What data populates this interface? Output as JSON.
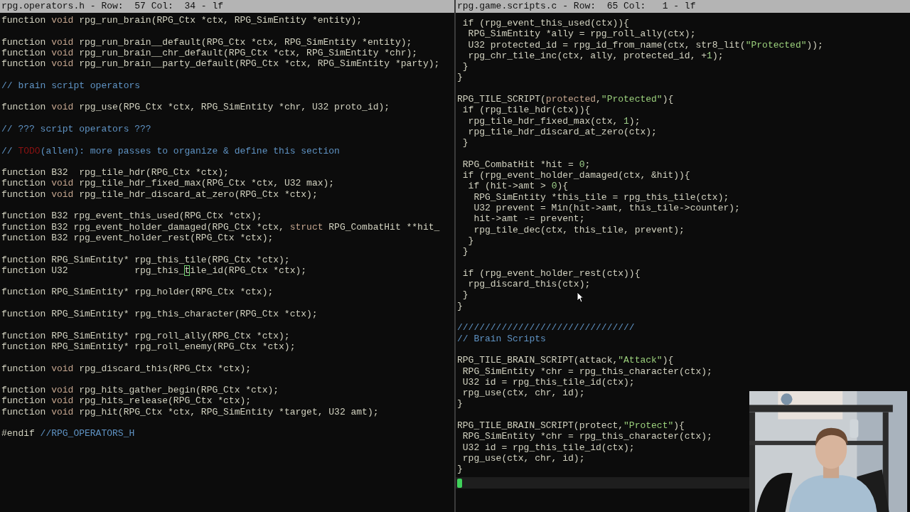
{
  "panes": [
    {
      "status_bar": "rpg.operators.h - Row:  57 Col:  34 - lf",
      "lines": [
        {
          "kind": "code",
          "tokens": [
            {
              "kind": "plain",
              "text": "function "
            },
            {
              "kind": "keyword",
              "text": "void"
            },
            {
              "kind": "plain",
              "text": " rpg_run_brain(RPG_Ctx *ctx, RPG_SimEntity *entity);"
            }
          ]
        },
        {
          "kind": "blank"
        },
        {
          "kind": "code",
          "tokens": [
            {
              "kind": "plain",
              "text": "function "
            },
            {
              "kind": "keyword",
              "text": "void"
            },
            {
              "kind": "plain",
              "text": " rpg_run_brain__default(RPG_Ctx *ctx, RPG_SimEntity *entity);"
            }
          ]
        },
        {
          "kind": "code",
          "tokens": [
            {
              "kind": "plain",
              "text": "function "
            },
            {
              "kind": "keyword",
              "text": "void"
            },
            {
              "kind": "plain",
              "text": " rpg_run_brain__chr_default(RPG_Ctx *ctx, RPG_SimEntity *chr);"
            }
          ]
        },
        {
          "kind": "code",
          "tokens": [
            {
              "kind": "plain",
              "text": "function "
            },
            {
              "kind": "keyword",
              "text": "void"
            },
            {
              "kind": "plain",
              "text": " rpg_run_brain__party_default(RPG_Ctx *ctx, RPG_SimEntity *party);"
            }
          ]
        },
        {
          "kind": "blank"
        },
        {
          "kind": "code",
          "tokens": [
            {
              "kind": "comment",
              "text": "// brain script operators"
            }
          ]
        },
        {
          "kind": "blank"
        },
        {
          "kind": "code",
          "tokens": [
            {
              "kind": "plain",
              "text": "function "
            },
            {
              "kind": "keyword",
              "text": "void"
            },
            {
              "kind": "plain",
              "text": " rpg_use(RPG_Ctx *ctx, RPG_SimEntity *chr, U32 proto_id);"
            }
          ]
        },
        {
          "kind": "blank"
        },
        {
          "kind": "code",
          "tokens": [
            {
              "kind": "comment",
              "text": "// ??? script operators ???"
            }
          ]
        },
        {
          "kind": "blank"
        },
        {
          "kind": "code",
          "tokens": [
            {
              "kind": "comment",
              "text": "// "
            },
            {
              "kind": "todo",
              "text": "TODO"
            },
            {
              "kind": "comment",
              "text": "(allen): more passes to organize & define this section"
            }
          ]
        },
        {
          "kind": "blank"
        },
        {
          "kind": "code",
          "tokens": [
            {
              "kind": "plain",
              "text": "function B32  rpg_tile_hdr(RPG_Ctx *ctx);"
            }
          ]
        },
        {
          "kind": "code",
          "tokens": [
            {
              "kind": "plain",
              "text": "function "
            },
            {
              "kind": "keyword",
              "text": "void"
            },
            {
              "kind": "plain",
              "text": " rpg_tile_hdr_fixed_max(RPG_Ctx *ctx, U32 max);"
            }
          ]
        },
        {
          "kind": "code",
          "tokens": [
            {
              "kind": "plain",
              "text": "function "
            },
            {
              "kind": "keyword",
              "text": "void"
            },
            {
              "kind": "plain",
              "text": " rpg_tile_hdr_discard_at_zero(RPG_Ctx *ctx);"
            }
          ]
        },
        {
          "kind": "blank"
        },
        {
          "kind": "code",
          "tokens": [
            {
              "kind": "plain",
              "text": "function B32 rpg_event_this_used(RPG_Ctx *ctx);"
            }
          ]
        },
        {
          "kind": "code",
          "tokens": [
            {
              "kind": "plain",
              "text": "function B32 rpg_event_holder_damaged(RPG_Ctx *ctx, "
            },
            {
              "kind": "keyword",
              "text": "struct"
            },
            {
              "kind": "plain",
              "text": " RPG_CombatHit **hit_"
            }
          ]
        },
        {
          "kind": "code",
          "tokens": [
            {
              "kind": "plain",
              "text": "function B32 rpg_event_holder_rest(RPG_Ctx *ctx);"
            }
          ]
        },
        {
          "kind": "blank"
        },
        {
          "kind": "code",
          "tokens": [
            {
              "kind": "plain",
              "text": "function RPG_SimEntity* rpg_this_tile(RPG_Ctx *ctx);"
            }
          ]
        },
        {
          "kind": "code",
          "tokens": [
            {
              "kind": "plain",
              "text": "function U32            rpg_this_"
            },
            {
              "kind": "cursor",
              "text": "t"
            },
            {
              "kind": "plain",
              "text": "ile_id(RPG_Ctx *ctx);"
            }
          ]
        },
        {
          "kind": "blank"
        },
        {
          "kind": "code",
          "tokens": [
            {
              "kind": "plain",
              "text": "function RPG_SimEntity* rpg_holder(RPG_Ctx *ctx);"
            }
          ]
        },
        {
          "kind": "blank"
        },
        {
          "kind": "code",
          "tokens": [
            {
              "kind": "plain",
              "text": "function RPG_SimEntity* rpg_this_character(RPG_Ctx *ctx);"
            }
          ]
        },
        {
          "kind": "blank"
        },
        {
          "kind": "code",
          "tokens": [
            {
              "kind": "plain",
              "text": "function RPG_SimEntity* rpg_roll_ally(RPG_Ctx *ctx);"
            }
          ]
        },
        {
          "kind": "code",
          "tokens": [
            {
              "kind": "plain",
              "text": "function RPG_SimEntity* rpg_roll_enemy(RPG_Ctx *ctx);"
            }
          ]
        },
        {
          "kind": "blank"
        },
        {
          "kind": "code",
          "tokens": [
            {
              "kind": "plain",
              "text": "function "
            },
            {
              "kind": "keyword",
              "text": "void"
            },
            {
              "kind": "plain",
              "text": " rpg_discard_this(RPG_Ctx *ctx);"
            }
          ]
        },
        {
          "kind": "blank"
        },
        {
          "kind": "code",
          "tokens": [
            {
              "kind": "plain",
              "text": "function "
            },
            {
              "kind": "keyword",
              "text": "void"
            },
            {
              "kind": "plain",
              "text": " rpg_hits_gather_begin(RPG_Ctx *ctx);"
            }
          ]
        },
        {
          "kind": "code",
          "tokens": [
            {
              "kind": "plain",
              "text": "function "
            },
            {
              "kind": "keyword",
              "text": "void"
            },
            {
              "kind": "plain",
              "text": " rpg_hits_release(RPG_Ctx *ctx);"
            }
          ]
        },
        {
          "kind": "code",
          "tokens": [
            {
              "kind": "plain",
              "text": "function "
            },
            {
              "kind": "keyword",
              "text": "void"
            },
            {
              "kind": "plain",
              "text": " rpg_hit(RPG_Ctx *ctx, RPG_SimEntity *target, U32 amt);"
            }
          ]
        },
        {
          "kind": "blank"
        },
        {
          "kind": "code",
          "tokens": [
            {
              "kind": "plain",
              "text": "#endif "
            },
            {
              "kind": "comment",
              "text": "//RPG_OPERATORS_H"
            }
          ]
        }
      ]
    },
    {
      "status_bar": "rpg.game.scripts.c - Row:  65 Col:   1 - lf",
      "lines": [
        {
          "kind": "code",
          "tokens": [
            {
              "kind": "plain",
              "text": " if (rpg_event_this_used(ctx)){"
            }
          ]
        },
        {
          "kind": "code",
          "tokens": [
            {
              "kind": "plain",
              "text": "  RPG_SimEntity *ally = rpg_roll_ally(ctx);"
            }
          ]
        },
        {
          "kind": "code",
          "tokens": [
            {
              "kind": "plain",
              "text": "  U32 protected_id = rpg_id_from_name(ctx, str8_lit("
            },
            {
              "kind": "string",
              "text": "\"Protected\""
            },
            {
              "kind": "plain",
              "text": "));"
            }
          ]
        },
        {
          "kind": "code",
          "tokens": [
            {
              "kind": "plain",
              "text": "  rpg_chr_tile_inc(ctx, ally, protected_id, +"
            },
            {
              "kind": "number",
              "text": "1"
            },
            {
              "kind": "plain",
              "text": ");"
            }
          ]
        },
        {
          "kind": "code",
          "tokens": [
            {
              "kind": "plain",
              "text": " }"
            }
          ]
        },
        {
          "kind": "code",
          "tokens": [
            {
              "kind": "plain",
              "text": "}"
            }
          ]
        },
        {
          "kind": "blank"
        },
        {
          "kind": "code",
          "tokens": [
            {
              "kind": "plain",
              "text": "RPG_TILE_SCRIPT("
            },
            {
              "kind": "keyword",
              "text": "protected"
            },
            {
              "kind": "plain",
              "text": ","
            },
            {
              "kind": "string",
              "text": "\"Protected\""
            },
            {
              "kind": "plain",
              "text": "){"
            }
          ]
        },
        {
          "kind": "code",
          "tokens": [
            {
              "kind": "plain",
              "text": " if (rpg_tile_hdr(ctx)){"
            }
          ]
        },
        {
          "kind": "code",
          "tokens": [
            {
              "kind": "plain",
              "text": "  rpg_tile_hdr_fixed_max(ctx, "
            },
            {
              "kind": "number",
              "text": "1"
            },
            {
              "kind": "plain",
              "text": ");"
            }
          ]
        },
        {
          "kind": "code",
          "tokens": [
            {
              "kind": "plain",
              "text": "  rpg_tile_hdr_discard_at_zero(ctx);"
            }
          ]
        },
        {
          "kind": "code",
          "tokens": [
            {
              "kind": "plain",
              "text": " }"
            }
          ]
        },
        {
          "kind": "blank"
        },
        {
          "kind": "code",
          "tokens": [
            {
              "kind": "plain",
              "text": " RPG_CombatHit *hit = "
            },
            {
              "kind": "number",
              "text": "0"
            },
            {
              "kind": "plain",
              "text": ";"
            }
          ]
        },
        {
          "kind": "code",
          "tokens": [
            {
              "kind": "plain",
              "text": " if (rpg_event_holder_damaged(ctx, &hit)){"
            }
          ]
        },
        {
          "kind": "code",
          "tokens": [
            {
              "kind": "plain",
              "text": "  if (hit->amt > "
            },
            {
              "kind": "number",
              "text": "0"
            },
            {
              "kind": "plain",
              "text": "){"
            }
          ]
        },
        {
          "kind": "code",
          "tokens": [
            {
              "kind": "plain",
              "text": "   RPG_SimEntity *this_tile = rpg_this_tile(ctx);"
            }
          ]
        },
        {
          "kind": "code",
          "tokens": [
            {
              "kind": "plain",
              "text": "   U32 prevent = Min(hit->amt, this_tile->counter);"
            }
          ]
        },
        {
          "kind": "code",
          "tokens": [
            {
              "kind": "plain",
              "text": "   hit->amt -= prevent;"
            }
          ]
        },
        {
          "kind": "code",
          "tokens": [
            {
              "kind": "plain",
              "text": "   rpg_tile_dec(ctx, this_tile, prevent);"
            }
          ]
        },
        {
          "kind": "code",
          "tokens": [
            {
              "kind": "plain",
              "text": "  }"
            }
          ]
        },
        {
          "kind": "code",
          "tokens": [
            {
              "kind": "plain",
              "text": " }"
            }
          ]
        },
        {
          "kind": "blank"
        },
        {
          "kind": "code",
          "tokens": [
            {
              "kind": "plain",
              "text": " if (rpg_event_holder_rest(ctx)){"
            }
          ]
        },
        {
          "kind": "code",
          "tokens": [
            {
              "kind": "plain",
              "text": "  rpg_discard_this(ctx);"
            }
          ]
        },
        {
          "kind": "code",
          "tokens": [
            {
              "kind": "plain",
              "text": " }"
            }
          ]
        },
        {
          "kind": "code",
          "tokens": [
            {
              "kind": "plain",
              "text": "}"
            }
          ]
        },
        {
          "kind": "blank"
        },
        {
          "kind": "code",
          "tokens": [
            {
              "kind": "comment",
              "text": "////////////////////////////////"
            }
          ]
        },
        {
          "kind": "code",
          "tokens": [
            {
              "kind": "comment",
              "text": "// Brain Scripts"
            }
          ]
        },
        {
          "kind": "blank"
        },
        {
          "kind": "code",
          "tokens": [
            {
              "kind": "plain",
              "text": "RPG_TILE_BRAIN_SCRIPT(attack,"
            },
            {
              "kind": "string",
              "text": "\"Attack\""
            },
            {
              "kind": "plain",
              "text": "){"
            }
          ]
        },
        {
          "kind": "code",
          "tokens": [
            {
              "kind": "plain",
              "text": " RPG_SimEntity *chr = rpg_this_character(ctx);"
            }
          ]
        },
        {
          "kind": "code",
          "tokens": [
            {
              "kind": "plain",
              "text": " U32 id = rpg_this_tile_id(ctx);"
            }
          ]
        },
        {
          "kind": "code",
          "tokens": [
            {
              "kind": "plain",
              "text": " rpg_use(ctx, chr, id);"
            }
          ]
        },
        {
          "kind": "code",
          "tokens": [
            {
              "kind": "plain",
              "text": "}"
            }
          ]
        },
        {
          "kind": "blank"
        },
        {
          "kind": "code",
          "tokens": [
            {
              "kind": "plain",
              "text": "RPG_TILE_BRAIN_SCRIPT(protect,"
            },
            {
              "kind": "string",
              "text": "\"Protect\""
            },
            {
              "kind": "plain",
              "text": "){"
            }
          ]
        },
        {
          "kind": "code",
          "tokens": [
            {
              "kind": "plain",
              "text": " RPG_SimEntity *chr = rpg_this_character(ctx);"
            }
          ]
        },
        {
          "kind": "code",
          "tokens": [
            {
              "kind": "plain",
              "text": " U32 id = rpg_this_tile_id(ctx);"
            }
          ]
        },
        {
          "kind": "code",
          "tokens": [
            {
              "kind": "plain",
              "text": " rpg_use(ctx, chr, id);"
            }
          ]
        },
        {
          "kind": "code",
          "tokens": [
            {
              "kind": "plain",
              "text": "}"
            }
          ]
        },
        {
          "kind": "cursor"
        }
      ]
    }
  ]
}
